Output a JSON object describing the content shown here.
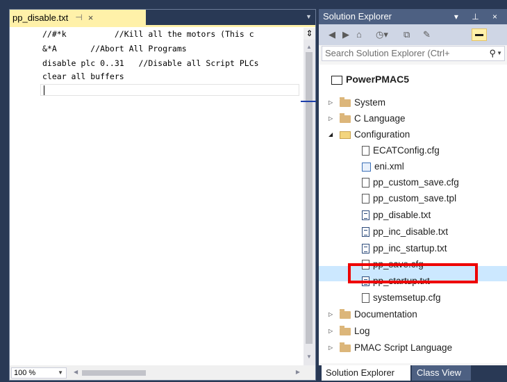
{
  "editor": {
    "tab_title": "pp_disable.txt",
    "tab_pin": "⊣",
    "tab_close": "×",
    "code_lines": [
      "//#*k          //Kill all the motors (This c",
      "&*A       //Abort All Programs",
      "disable plc 0..31   //Disable all Script PLCs",
      "clear all buffers"
    ],
    "zoom": "100 %"
  },
  "solution_explorer": {
    "title": "Solution Explorer",
    "title_icons": "▾ ⊥ ×",
    "search_placeholder": "Search Solution Explorer (Ctrl+",
    "tree": {
      "root": "PowerPMAC5",
      "items": [
        {
          "label": "System",
          "icon": "folder-icon",
          "expander": "collapsed"
        },
        {
          "label": "C Language",
          "icon": "folder-icon",
          "expander": "collapsed"
        },
        {
          "label": "Configuration",
          "icon": "folder-open-icon",
          "expander": "expanded"
        },
        {
          "label": "ECATConfig.cfg",
          "icon": "file-icon"
        },
        {
          "label": "eni.xml",
          "icon": "xml-file-icon"
        },
        {
          "label": "pp_custom_save.cfg",
          "icon": "file-icon"
        },
        {
          "label": "pp_custom_save.tpl",
          "icon": "file-icon"
        },
        {
          "label": "pp_disable.txt",
          "icon": "text-file-icon",
          "selected": true
        },
        {
          "label": "pp_inc_disable.txt",
          "icon": "text-file-icon"
        },
        {
          "label": "pp_inc_startup.txt",
          "icon": "text-file-icon"
        },
        {
          "label": "pp_save.cfg",
          "icon": "file-icon"
        },
        {
          "label": "pp_startup.txt",
          "icon": "text-file-icon"
        },
        {
          "label": "systemsetup.cfg",
          "icon": "file-icon"
        },
        {
          "label": "Documentation",
          "icon": "folder-icon",
          "expander": "collapsed"
        },
        {
          "label": "Log",
          "icon": "folder-icon",
          "expander": "collapsed"
        },
        {
          "label": "PMAC Script Language",
          "icon": "folder-icon",
          "expander": "collapsed"
        }
      ]
    },
    "bottom_tabs": [
      "Solution Explorer",
      "Class View"
    ]
  },
  "colors": {
    "frame": "#293955",
    "active_tab": "#fff1a9",
    "selection": "#cce8ff",
    "highlight_box": "#ee0000"
  }
}
